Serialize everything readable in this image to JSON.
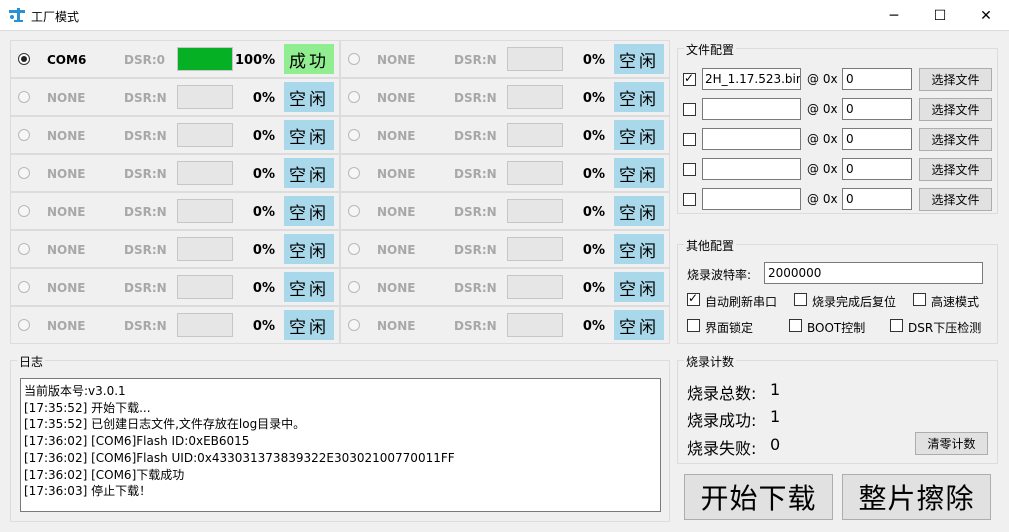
{
  "window": {
    "title": "工厂模式",
    "minimize_glyph": "─",
    "maximize_glyph": "☐",
    "close_glyph": "✕"
  },
  "ports": [
    {
      "selected": true,
      "name": "COM6",
      "dsr": "DSR:0",
      "progress": 1.0,
      "percent": "100%",
      "status": "成功",
      "status_type": "success"
    },
    {
      "selected": false,
      "name": "NONE",
      "dsr": "DSR:N",
      "progress": 0,
      "percent": "0%",
      "status": "空闲",
      "status_type": "idle"
    },
    {
      "selected": false,
      "name": "NONE",
      "dsr": "DSR:N",
      "progress": 0,
      "percent": "0%",
      "status": "空闲",
      "status_type": "idle"
    },
    {
      "selected": false,
      "name": "NONE",
      "dsr": "DSR:N",
      "progress": 0,
      "percent": "0%",
      "status": "空闲",
      "status_type": "idle"
    },
    {
      "selected": false,
      "name": "NONE",
      "dsr": "DSR:N",
      "progress": 0,
      "percent": "0%",
      "status": "空闲",
      "status_type": "idle"
    },
    {
      "selected": false,
      "name": "NONE",
      "dsr": "DSR:N",
      "progress": 0,
      "percent": "0%",
      "status": "空闲",
      "status_type": "idle"
    },
    {
      "selected": false,
      "name": "NONE",
      "dsr": "DSR:N",
      "progress": 0,
      "percent": "0%",
      "status": "空闲",
      "status_type": "idle"
    },
    {
      "selected": false,
      "name": "NONE",
      "dsr": "DSR:N",
      "progress": 0,
      "percent": "0%",
      "status": "空闲",
      "status_type": "idle"
    },
    {
      "selected": false,
      "name": "NONE",
      "dsr": "DSR:N",
      "progress": 0,
      "percent": "0%",
      "status": "空闲",
      "status_type": "idle"
    },
    {
      "selected": false,
      "name": "NONE",
      "dsr": "DSR:N",
      "progress": 0,
      "percent": "0%",
      "status": "空闲",
      "status_type": "idle"
    },
    {
      "selected": false,
      "name": "NONE",
      "dsr": "DSR:N",
      "progress": 0,
      "percent": "0%",
      "status": "空闲",
      "status_type": "idle"
    },
    {
      "selected": false,
      "name": "NONE",
      "dsr": "DSR:N",
      "progress": 0,
      "percent": "0%",
      "status": "空闲",
      "status_type": "idle"
    },
    {
      "selected": false,
      "name": "NONE",
      "dsr": "DSR:N",
      "progress": 0,
      "percent": "0%",
      "status": "空闲",
      "status_type": "idle"
    },
    {
      "selected": false,
      "name": "NONE",
      "dsr": "DSR:N",
      "progress": 0,
      "percent": "0%",
      "status": "空闲",
      "status_type": "idle"
    },
    {
      "selected": false,
      "name": "NONE",
      "dsr": "DSR:N",
      "progress": 0,
      "percent": "0%",
      "status": "空闲",
      "status_type": "idle"
    },
    {
      "selected": false,
      "name": "NONE",
      "dsr": "DSR:N",
      "progress": 0,
      "percent": "0%",
      "status": "空闲",
      "status_type": "idle"
    }
  ],
  "log": {
    "title": "日志",
    "lines": [
      "当前版本号:v3.0.1",
      "[17:35:52] 开始下载...",
      "[17:35:52] 已创建日志文件,文件存放在log目录中。",
      "[17:36:02] [COM6]Flash ID:0xEB6015",
      "[17:36:02] [COM6]Flash UID:0x433031373839322E30302100770011FF",
      "[17:36:02] [COM6]下载成功",
      "[17:36:03] 停止下载！"
    ]
  },
  "file_config": {
    "title": "文件配置",
    "at_label": "@ 0x",
    "choose_label": "选择文件",
    "files": [
      {
        "checked": true,
        "path": "2H_1.17.523.bin",
        "address": "0"
      },
      {
        "checked": false,
        "path": "",
        "address": "0"
      },
      {
        "checked": false,
        "path": "",
        "address": "0"
      },
      {
        "checked": false,
        "path": "",
        "address": "0"
      },
      {
        "checked": false,
        "path": "",
        "address": "0"
      }
    ]
  },
  "other_config": {
    "title": "其他配置",
    "baud_label": "烧录波特率:",
    "baud_value": "2000000",
    "options": [
      {
        "label": "自动刷新串口",
        "checked": true
      },
      {
        "label": "烧录完成后复位",
        "checked": false
      },
      {
        "label": "高速模式",
        "checked": false
      },
      {
        "label": "界面锁定",
        "checked": false
      },
      {
        "label": "BOOT控制",
        "checked": false
      },
      {
        "label": "DSR下压检测",
        "checked": false
      }
    ]
  },
  "counter": {
    "title": "烧录计数",
    "total_label": "烧录总数:",
    "total_value": "1",
    "success_label": "烧录成功:",
    "success_value": "1",
    "fail_label": "烧录失败:",
    "fail_value": "0",
    "clear_label": "清零计数"
  },
  "actions": {
    "start_label": "开始下载",
    "erase_label": "整片擦除"
  },
  "colors": {
    "success_bg": "#90ee90",
    "idle_bg": "#a8d8ea",
    "progress_fill": "#06b025"
  }
}
